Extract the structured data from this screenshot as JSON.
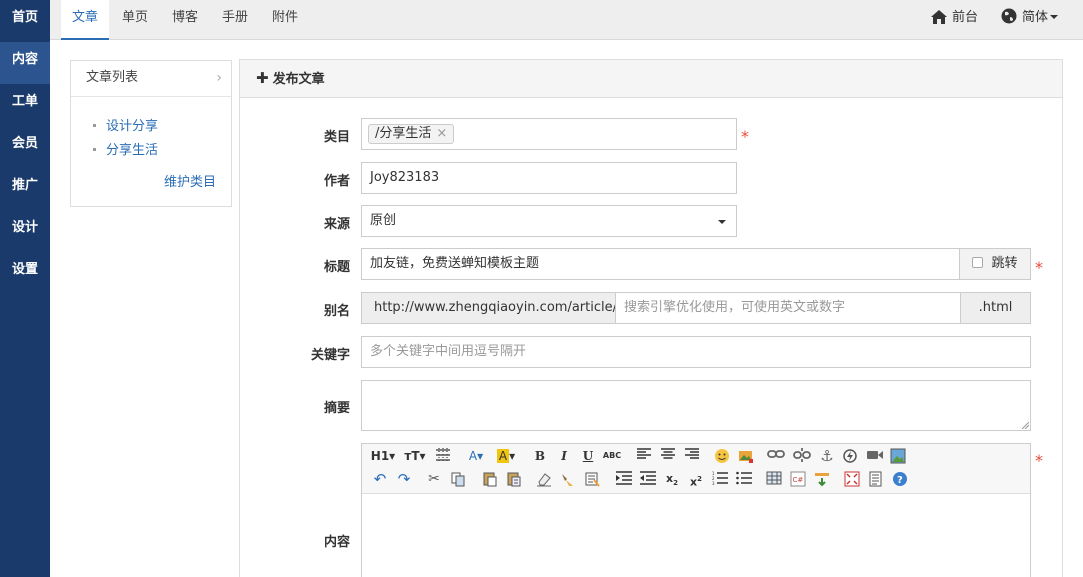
{
  "left_nav": [
    "首页",
    "内容",
    "工单",
    "会员",
    "推广",
    "设计",
    "设置"
  ],
  "top_tabs": [
    "文章",
    "单页",
    "博客",
    "手册",
    "附件"
  ],
  "top_right": {
    "front": "前台",
    "lang": "简体"
  },
  "sidebar": {
    "title": "文章列表",
    "categories": [
      "设计分享",
      "分享生活"
    ],
    "maintain": "维护类目"
  },
  "panel": {
    "title": "发布文章"
  },
  "form": {
    "category": {
      "label": "类目",
      "chip": "/分享生活",
      "required_mark": "*"
    },
    "author": {
      "label": "作者",
      "value": "Joy823183"
    },
    "source": {
      "label": "来源",
      "value": "原创"
    },
    "title": {
      "label": "标题",
      "value": "加友链，免费送蝉知模板主题",
      "redirect_label": "跳转",
      "required_mark": "*"
    },
    "alias": {
      "label": "别名",
      "prefix": "http://www.zhengqiaoyin.com/article/id_",
      "placeholder": "搜索引擎优化使用，可使用英文或数字",
      "suffix": ".html"
    },
    "keywords": {
      "label": "关键字",
      "placeholder": "多个关键字中间用逗号隔开"
    },
    "summary": {
      "label": "摘要"
    },
    "content": {
      "label": "内容",
      "required_mark": "*"
    }
  },
  "toolbar": {
    "row1": [
      "heading",
      "font-size",
      "text-align-justify",
      "font-color",
      "highlight-color",
      "bold",
      "italic",
      "underline",
      "strikethrough",
      "align-left",
      "align-center",
      "align-right",
      "emoticon",
      "insert-image",
      "link",
      "unlink",
      "anchor",
      "flash",
      "media",
      "image"
    ],
    "row2": [
      "undo",
      "redo",
      "cut",
      "copy",
      "paste",
      "paste-plain",
      "paste-word",
      "clear-format",
      "format-brush",
      "quick-format",
      "indent",
      "outdent",
      "subscript",
      "superscript",
      "ordered-list",
      "unordered-list",
      "table",
      "code",
      "insert-hr",
      "fullscreen",
      "source",
      "help"
    ]
  },
  "colors": {
    "nav_bg": "#1a3a6b",
    "nav_active": "#2c558f",
    "link": "#2a6db5",
    "required": "#e74c3c"
  }
}
